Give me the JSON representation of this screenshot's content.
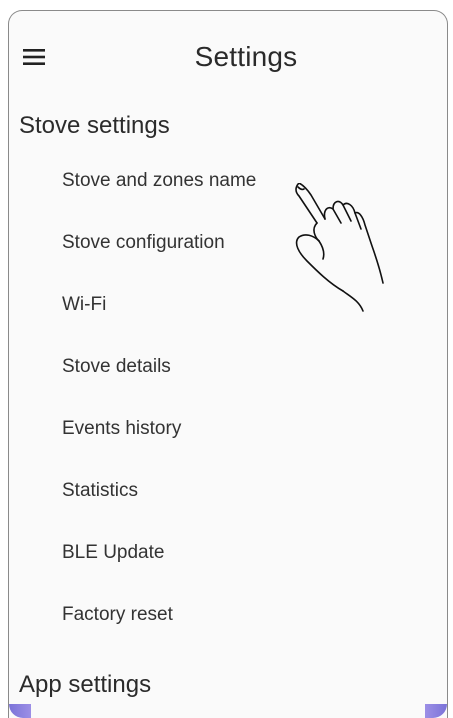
{
  "header": {
    "title": "Settings",
    "menu_icon": "hamburger-menu-icon"
  },
  "stove_settings": {
    "heading": "Stove settings",
    "items": [
      {
        "label": "Stove and zones name"
      },
      {
        "label": "Stove configuration"
      },
      {
        "label": "Wi-Fi"
      },
      {
        "label": "Stove details"
      },
      {
        "label": "Events history"
      },
      {
        "label": "Statistics"
      },
      {
        "label": "BLE Update"
      },
      {
        "label": "Factory reset"
      }
    ]
  },
  "app_settings": {
    "heading": "App settings"
  },
  "overlay": {
    "pointer_icon": "tap-hand-icon"
  },
  "colors": {
    "background": "#fafafa",
    "text": "#333333",
    "accent": "#7b73d8"
  }
}
